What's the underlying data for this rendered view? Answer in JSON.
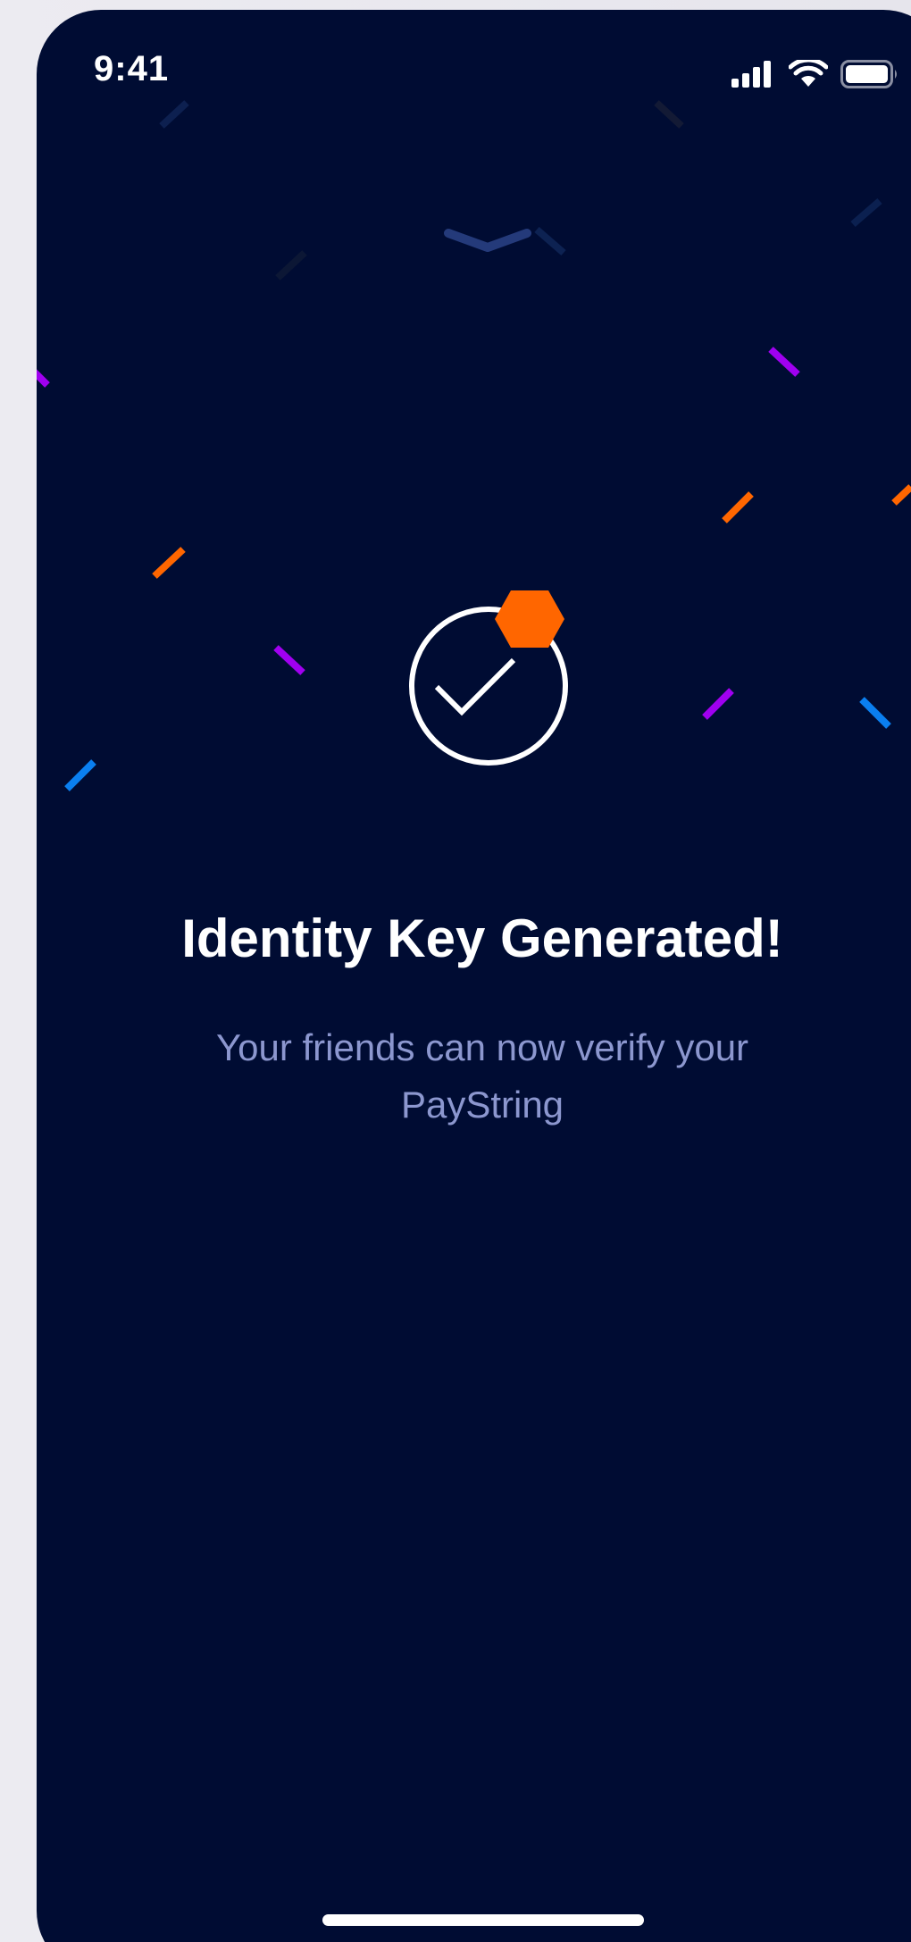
{
  "status_bar": {
    "time": "9:41",
    "icons": [
      "cellular-signal-icon",
      "wifi-icon",
      "battery-icon"
    ]
  },
  "success": {
    "icon": "checkmark-circle-icon",
    "badge_icon": "hexagon-badge-icon",
    "title": "Identity Key Generated!",
    "subtitle": "Your friends can now verify your PayString"
  },
  "colors": {
    "background": "#000c33",
    "title": "#ffffff",
    "subtitle": "#8c97cf",
    "accent_orange": "#ff6600",
    "accent_purple": "#a000f0",
    "accent_blue": "#0a7ff0",
    "handle": "#243a7a"
  }
}
